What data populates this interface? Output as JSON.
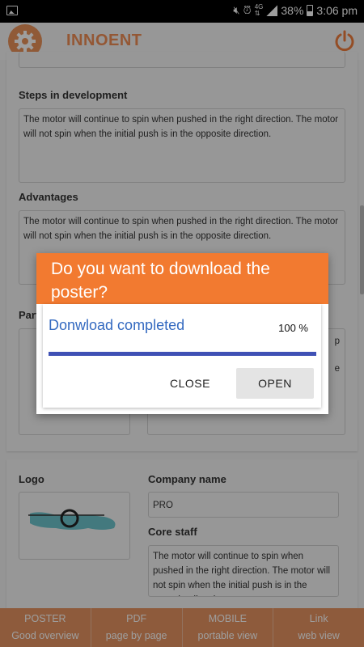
{
  "status_bar": {
    "battery": "38%",
    "time": "3:06 pm",
    "network": "4G",
    "icons": [
      "image-icon",
      "mute-icon",
      "alarm-icon",
      "signal-icon",
      "battery-icon"
    ]
  },
  "app_bar": {
    "title": "INNOENT",
    "icons": [
      "gear-icon",
      "power-icon"
    ],
    "accent": "#ef8d55"
  },
  "form": {
    "steps_label": "Steps in development",
    "steps_text": "The motor will continue to spin when pushed in the right direction. The motor will not spin when the initial push is in the opposite direction.",
    "advantages_label": "Advantages",
    "advantages_text": "The motor will continue to spin when pushed in the right direction. The motor will not spin when the initial push is in the opposite direction.",
    "partial_label": "Part",
    "right_box_fragment_1": "p",
    "right_box_fragment_2": "e",
    "logo_label": "Logo",
    "company_label": "Company name",
    "company_value": "PRO",
    "core_staff_label": "Core staff",
    "core_staff_text": "The motor will continue to spin when pushed in the right direction. The motor will not spin when the initial push is in the opposite direction."
  },
  "dialog": {
    "title": "Do you want to download the poster?",
    "status": "Donwload completed",
    "percent": "100 %",
    "progress": 1.0,
    "close_label": "CLOSE",
    "open_label": "OPEN",
    "header_color": "#f27a30",
    "progress_color": "#3f51b5"
  },
  "bottom_nav": [
    {
      "title": "POSTER",
      "subtitle": "Good overview"
    },
    {
      "title": "PDF",
      "subtitle": "page by page"
    },
    {
      "title": "MOBILE",
      "subtitle": "portable view"
    },
    {
      "title": "Link",
      "subtitle": "web view"
    }
  ]
}
